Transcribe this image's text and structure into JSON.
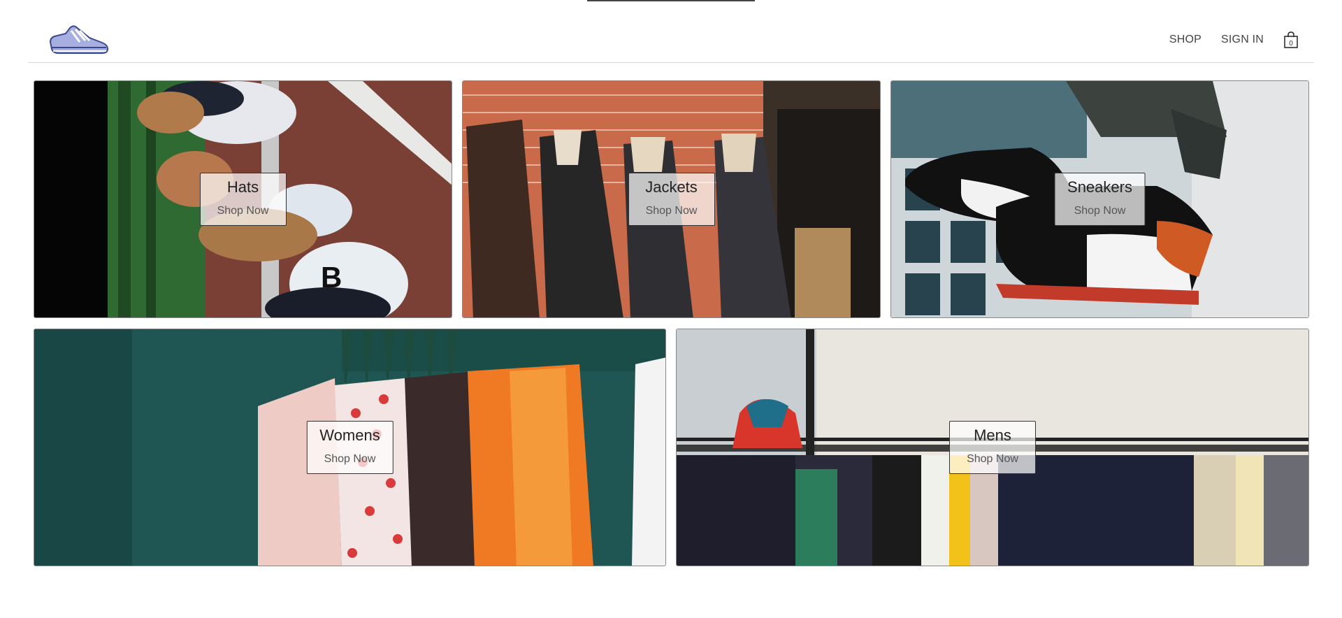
{
  "header": {
    "logo": "sneaker-logo",
    "nav": {
      "shop": "SHOP",
      "sign_in": "SIGN IN"
    },
    "cart": {
      "icon": "shopping-bag-icon",
      "count": "0"
    }
  },
  "categories": [
    {
      "title": "Hats",
      "cta": "Shop Now"
    },
    {
      "title": "Jackets",
      "cta": "Shop Now"
    },
    {
      "title": "Sneakers",
      "cta": "Shop Now"
    },
    {
      "title": "Womens",
      "cta": "Shop Now"
    },
    {
      "title": "Mens",
      "cta": "Shop Now"
    }
  ]
}
